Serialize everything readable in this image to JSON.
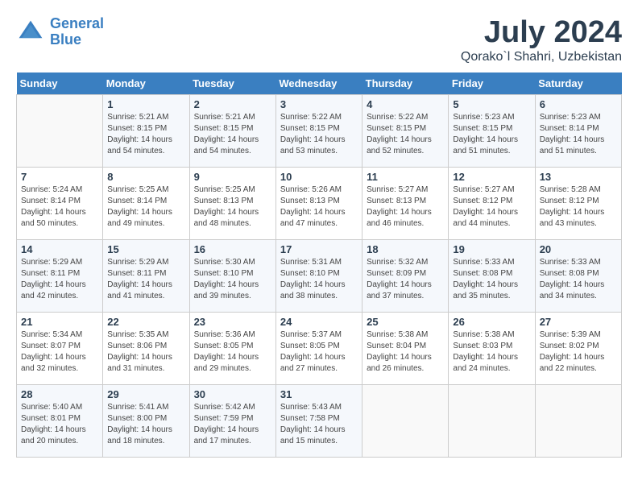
{
  "logo": {
    "text_general": "General",
    "text_blue": "Blue"
  },
  "title": {
    "month_year": "July 2024",
    "location": "Qorako`l Shahri, Uzbekistan"
  },
  "header": {
    "days": [
      "Sunday",
      "Monday",
      "Tuesday",
      "Wednesday",
      "Thursday",
      "Friday",
      "Saturday"
    ]
  },
  "weeks": [
    {
      "cells": [
        {
          "day": "",
          "info": ""
        },
        {
          "day": "1",
          "info": "Sunrise: 5:21 AM\nSunset: 8:15 PM\nDaylight: 14 hours\nand 54 minutes."
        },
        {
          "day": "2",
          "info": "Sunrise: 5:21 AM\nSunset: 8:15 PM\nDaylight: 14 hours\nand 54 minutes."
        },
        {
          "day": "3",
          "info": "Sunrise: 5:22 AM\nSunset: 8:15 PM\nDaylight: 14 hours\nand 53 minutes."
        },
        {
          "day": "4",
          "info": "Sunrise: 5:22 AM\nSunset: 8:15 PM\nDaylight: 14 hours\nand 52 minutes."
        },
        {
          "day": "5",
          "info": "Sunrise: 5:23 AM\nSunset: 8:15 PM\nDaylight: 14 hours\nand 51 minutes."
        },
        {
          "day": "6",
          "info": "Sunrise: 5:23 AM\nSunset: 8:14 PM\nDaylight: 14 hours\nand 51 minutes."
        }
      ]
    },
    {
      "cells": [
        {
          "day": "7",
          "info": "Sunrise: 5:24 AM\nSunset: 8:14 PM\nDaylight: 14 hours\nand 50 minutes."
        },
        {
          "day": "8",
          "info": "Sunrise: 5:25 AM\nSunset: 8:14 PM\nDaylight: 14 hours\nand 49 minutes."
        },
        {
          "day": "9",
          "info": "Sunrise: 5:25 AM\nSunset: 8:13 PM\nDaylight: 14 hours\nand 48 minutes."
        },
        {
          "day": "10",
          "info": "Sunrise: 5:26 AM\nSunset: 8:13 PM\nDaylight: 14 hours\nand 47 minutes."
        },
        {
          "day": "11",
          "info": "Sunrise: 5:27 AM\nSunset: 8:13 PM\nDaylight: 14 hours\nand 46 minutes."
        },
        {
          "day": "12",
          "info": "Sunrise: 5:27 AM\nSunset: 8:12 PM\nDaylight: 14 hours\nand 44 minutes."
        },
        {
          "day": "13",
          "info": "Sunrise: 5:28 AM\nSunset: 8:12 PM\nDaylight: 14 hours\nand 43 minutes."
        }
      ]
    },
    {
      "cells": [
        {
          "day": "14",
          "info": "Sunrise: 5:29 AM\nSunset: 8:11 PM\nDaylight: 14 hours\nand 42 minutes."
        },
        {
          "day": "15",
          "info": "Sunrise: 5:29 AM\nSunset: 8:11 PM\nDaylight: 14 hours\nand 41 minutes."
        },
        {
          "day": "16",
          "info": "Sunrise: 5:30 AM\nSunset: 8:10 PM\nDaylight: 14 hours\nand 39 minutes."
        },
        {
          "day": "17",
          "info": "Sunrise: 5:31 AM\nSunset: 8:10 PM\nDaylight: 14 hours\nand 38 minutes."
        },
        {
          "day": "18",
          "info": "Sunrise: 5:32 AM\nSunset: 8:09 PM\nDaylight: 14 hours\nand 37 minutes."
        },
        {
          "day": "19",
          "info": "Sunrise: 5:33 AM\nSunset: 8:08 PM\nDaylight: 14 hours\nand 35 minutes."
        },
        {
          "day": "20",
          "info": "Sunrise: 5:33 AM\nSunset: 8:08 PM\nDaylight: 14 hours\nand 34 minutes."
        }
      ]
    },
    {
      "cells": [
        {
          "day": "21",
          "info": "Sunrise: 5:34 AM\nSunset: 8:07 PM\nDaylight: 14 hours\nand 32 minutes."
        },
        {
          "day": "22",
          "info": "Sunrise: 5:35 AM\nSunset: 8:06 PM\nDaylight: 14 hours\nand 31 minutes."
        },
        {
          "day": "23",
          "info": "Sunrise: 5:36 AM\nSunset: 8:05 PM\nDaylight: 14 hours\nand 29 minutes."
        },
        {
          "day": "24",
          "info": "Sunrise: 5:37 AM\nSunset: 8:05 PM\nDaylight: 14 hours\nand 27 minutes."
        },
        {
          "day": "25",
          "info": "Sunrise: 5:38 AM\nSunset: 8:04 PM\nDaylight: 14 hours\nand 26 minutes."
        },
        {
          "day": "26",
          "info": "Sunrise: 5:38 AM\nSunset: 8:03 PM\nDaylight: 14 hours\nand 24 minutes."
        },
        {
          "day": "27",
          "info": "Sunrise: 5:39 AM\nSunset: 8:02 PM\nDaylight: 14 hours\nand 22 minutes."
        }
      ]
    },
    {
      "cells": [
        {
          "day": "28",
          "info": "Sunrise: 5:40 AM\nSunset: 8:01 PM\nDaylight: 14 hours\nand 20 minutes."
        },
        {
          "day": "29",
          "info": "Sunrise: 5:41 AM\nSunset: 8:00 PM\nDaylight: 14 hours\nand 18 minutes."
        },
        {
          "day": "30",
          "info": "Sunrise: 5:42 AM\nSunset: 7:59 PM\nDaylight: 14 hours\nand 17 minutes."
        },
        {
          "day": "31",
          "info": "Sunrise: 5:43 AM\nSunset: 7:58 PM\nDaylight: 14 hours\nand 15 minutes."
        },
        {
          "day": "",
          "info": ""
        },
        {
          "day": "",
          "info": ""
        },
        {
          "day": "",
          "info": ""
        }
      ]
    }
  ]
}
